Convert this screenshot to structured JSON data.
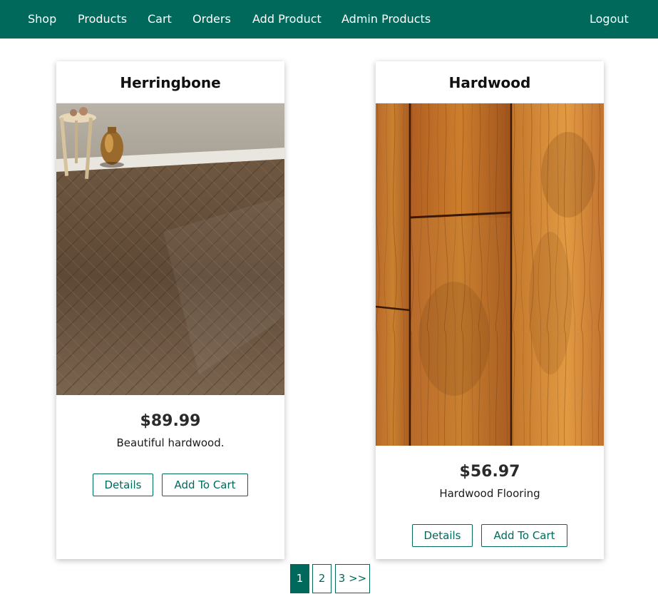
{
  "nav": {
    "shop": "Shop",
    "products": "Products",
    "cart": "Cart",
    "orders": "Orders",
    "add_product": "Add Product",
    "admin_products": "Admin Products",
    "logout": "Logout"
  },
  "products": [
    {
      "title": "Herringbone",
      "price": "$89.99",
      "description": "Beautiful hardwood.",
      "details_label": "Details",
      "add_to_cart_label": "Add To Cart"
    },
    {
      "title": "Hardwood",
      "price": "$56.97",
      "description": "Hardwood Flooring",
      "details_label": "Details",
      "add_to_cart_label": "Add To Cart"
    }
  ],
  "pagination": {
    "page1": "1",
    "page2": "2",
    "page3_next": "3 >>"
  },
  "colors": {
    "brand": "#00695c"
  }
}
